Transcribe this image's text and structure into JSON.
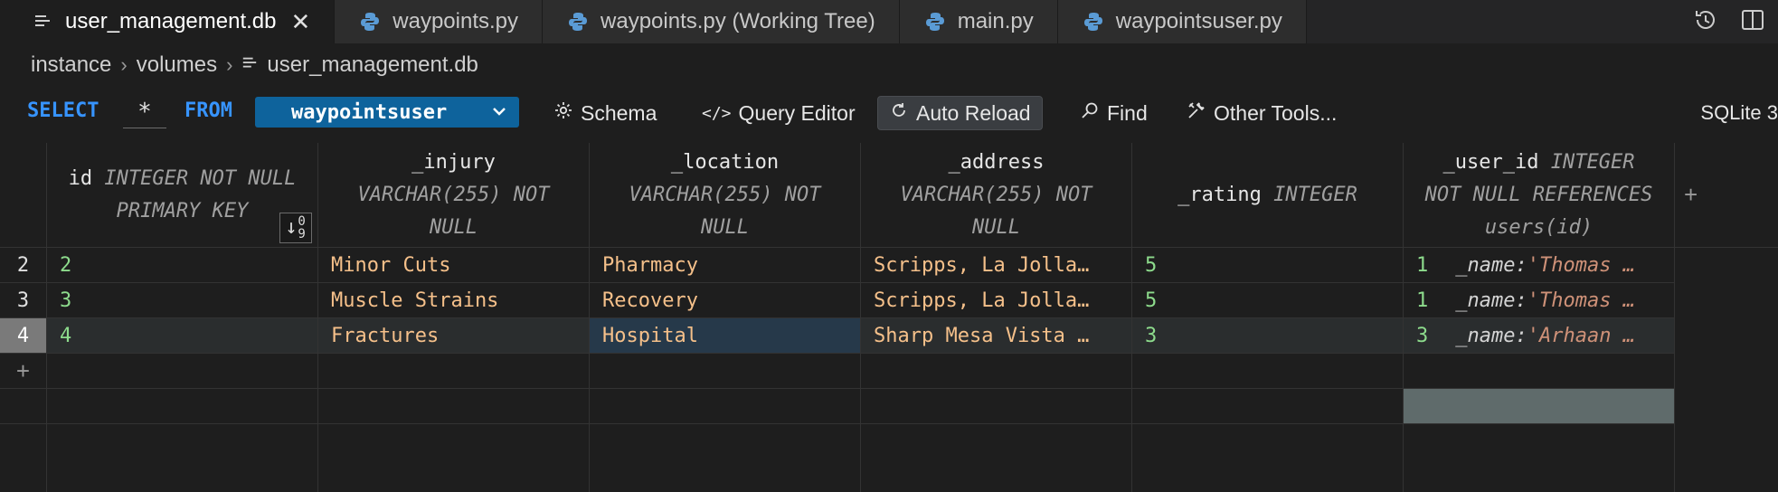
{
  "tabs": [
    {
      "label": "user_management.db",
      "icon": "list-icon",
      "active": true
    },
    {
      "label": "waypoints.py",
      "icon": "python-icon"
    },
    {
      "label": "waypoints.py (Working Tree)",
      "icon": "python-icon"
    },
    {
      "label": "main.py",
      "icon": "python-icon"
    },
    {
      "label": "waypointsuser.py",
      "icon": "python-icon"
    }
  ],
  "breadcrumb": [
    "instance",
    "volumes",
    "user_management.db"
  ],
  "query": {
    "select": "SELECT",
    "columns": "*",
    "from": "FROM",
    "table": "waypointsuser"
  },
  "toolbar": {
    "schema": "Schema",
    "query_editor": "Query Editor",
    "auto_reload": "Auto Reload",
    "find": "Find",
    "other_tools": "Other Tools...",
    "engine": "SQLite 3"
  },
  "columns": [
    {
      "name": "id",
      "type_lines": [
        "INTEGER NOT NULL",
        "PRIMARY KEY"
      ],
      "sort_indicator": "0 9"
    },
    {
      "name": "_injury",
      "type_lines": [
        "VARCHAR(255) NOT",
        "NULL"
      ]
    },
    {
      "name": "_location",
      "type_lines": [
        "VARCHAR(255) NOT",
        "NULL"
      ]
    },
    {
      "name": "_address",
      "type_lines": [
        "VARCHAR(255) NOT",
        "NULL"
      ]
    },
    {
      "name": "_rating",
      "type_lines": [
        "INTEGER"
      ]
    },
    {
      "name": "_user_id",
      "type_lines": [
        "INTEGER",
        "NOT NULL REFERENCES",
        "users(id)"
      ]
    }
  ],
  "rows": [
    {
      "rownum": "2",
      "id": "2",
      "injury": "Minor Cuts",
      "location": "Pharmacy",
      "address": "Scripps, La Jolla…",
      "rating": "5",
      "user_id": "1",
      "fk_key": "_name:",
      "fk_val": "'Thomas …"
    },
    {
      "rownum": "3",
      "id": "3",
      "injury": "Muscle Strains",
      "location": "Recovery",
      "address": "Scripps, La Jolla…",
      "rating": "5",
      "user_id": "1",
      "fk_key": "_name:",
      "fk_val": "'Thomas …"
    },
    {
      "rownum": "4",
      "id": "4",
      "injury": "Fractures",
      "location": "Hospital",
      "address": "Sharp Mesa Vista …",
      "rating": "3",
      "user_id": "3",
      "fk_key": "_name:",
      "fk_val": "'Arhaan …"
    }
  ],
  "add_row": "+",
  "add_column": "+"
}
